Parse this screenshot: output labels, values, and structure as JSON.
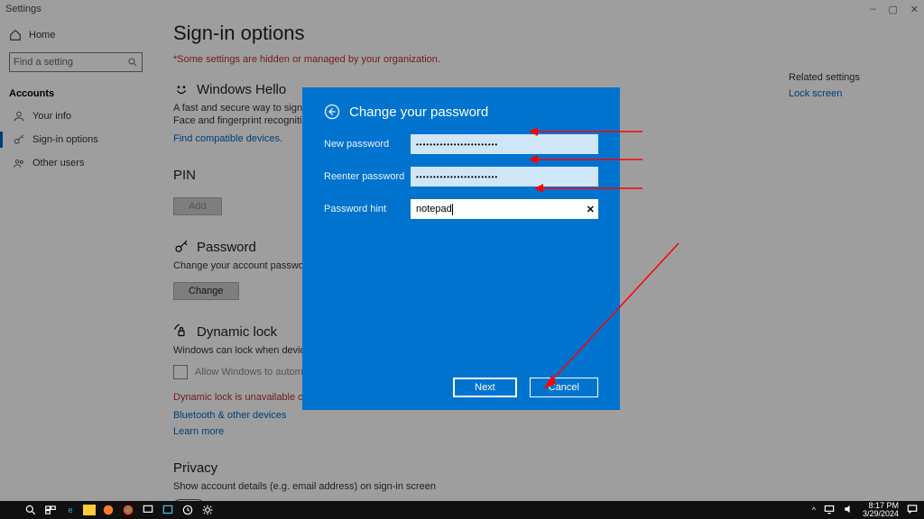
{
  "window": {
    "title": "Settings",
    "controls": [
      "–",
      "▢",
      "✕"
    ]
  },
  "rail": {
    "home": "Home",
    "search_placeholder": "Find a setting",
    "section": "Accounts",
    "items": [
      {
        "icon": "user",
        "label": "Your info"
      },
      {
        "icon": "key",
        "label": "Sign-in options",
        "active": true
      },
      {
        "icon": "people",
        "label": "Other users"
      }
    ]
  },
  "page": {
    "title": "Sign-in options",
    "org_warning": "*Some settings are hidden or managed by your organization.",
    "hello": {
      "heading": "Windows Hello",
      "desc": "A fast and secure way to sign in to Windows, make payments and connect to apps and services.",
      "note": "Face and fingerprint recognition are not available on this device.",
      "link": "Find compatible devices."
    },
    "pin": {
      "heading": "PIN",
      "button": "Add"
    },
    "password": {
      "heading": "Password",
      "desc": "Change your account password",
      "button": "Change"
    },
    "dynamic": {
      "heading": "Dynamic lock",
      "desc": "Windows can lock when devices paired to your PC go out of range.",
      "checkbox": "Allow Windows to automatically lock your device when you're away",
      "error": "Dynamic lock is unavailable over remote sessions.",
      "link1": "Bluetooth & other devices",
      "link2": "Learn more"
    },
    "privacy": {
      "heading": "Privacy",
      "desc": "Show account details (e.g. email address) on sign-in screen",
      "toggle": "Off"
    },
    "related": {
      "heading": "Related settings",
      "link": "Lock screen"
    }
  },
  "modal": {
    "title": "Change your password",
    "fields": {
      "new_label": "New password",
      "new_value": "••••••••••••••••••••••••",
      "re_label": "Reenter password",
      "re_value": "••••••••••••••••••••••••",
      "hint_label": "Password hint",
      "hint_value": "notepad"
    },
    "next": "Next",
    "cancel": "Cancel"
  },
  "taskbar": {
    "time": "8:17 PM",
    "date": "3/29/2024"
  }
}
